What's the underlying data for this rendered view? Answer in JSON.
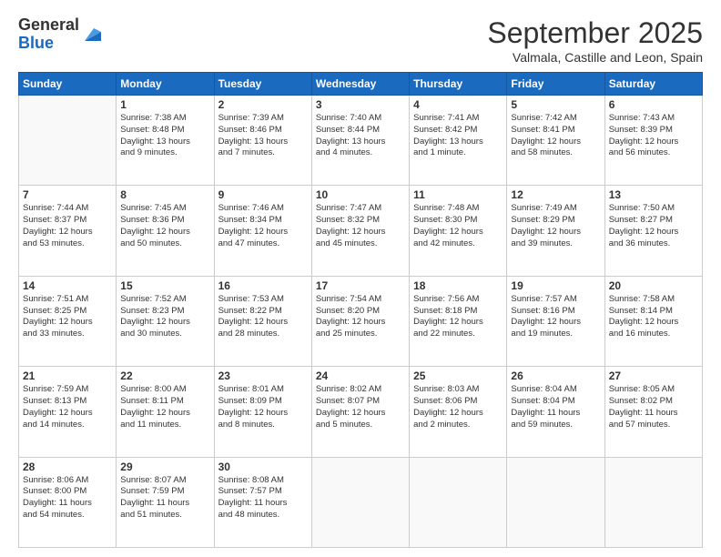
{
  "logo": {
    "general": "General",
    "blue": "Blue"
  },
  "header": {
    "month": "September 2025",
    "location": "Valmala, Castille and Leon, Spain"
  },
  "weekdays": [
    "Sunday",
    "Monday",
    "Tuesday",
    "Wednesday",
    "Thursday",
    "Friday",
    "Saturday"
  ],
  "weeks": [
    [
      {
        "day": "",
        "info": ""
      },
      {
        "day": "1",
        "info": "Sunrise: 7:38 AM\nSunset: 8:48 PM\nDaylight: 13 hours\nand 9 minutes."
      },
      {
        "day": "2",
        "info": "Sunrise: 7:39 AM\nSunset: 8:46 PM\nDaylight: 13 hours\nand 7 minutes."
      },
      {
        "day": "3",
        "info": "Sunrise: 7:40 AM\nSunset: 8:44 PM\nDaylight: 13 hours\nand 4 minutes."
      },
      {
        "day": "4",
        "info": "Sunrise: 7:41 AM\nSunset: 8:42 PM\nDaylight: 13 hours\nand 1 minute."
      },
      {
        "day": "5",
        "info": "Sunrise: 7:42 AM\nSunset: 8:41 PM\nDaylight: 12 hours\nand 58 minutes."
      },
      {
        "day": "6",
        "info": "Sunrise: 7:43 AM\nSunset: 8:39 PM\nDaylight: 12 hours\nand 56 minutes."
      }
    ],
    [
      {
        "day": "7",
        "info": "Sunrise: 7:44 AM\nSunset: 8:37 PM\nDaylight: 12 hours\nand 53 minutes."
      },
      {
        "day": "8",
        "info": "Sunrise: 7:45 AM\nSunset: 8:36 PM\nDaylight: 12 hours\nand 50 minutes."
      },
      {
        "day": "9",
        "info": "Sunrise: 7:46 AM\nSunset: 8:34 PM\nDaylight: 12 hours\nand 47 minutes."
      },
      {
        "day": "10",
        "info": "Sunrise: 7:47 AM\nSunset: 8:32 PM\nDaylight: 12 hours\nand 45 minutes."
      },
      {
        "day": "11",
        "info": "Sunrise: 7:48 AM\nSunset: 8:30 PM\nDaylight: 12 hours\nand 42 minutes."
      },
      {
        "day": "12",
        "info": "Sunrise: 7:49 AM\nSunset: 8:29 PM\nDaylight: 12 hours\nand 39 minutes."
      },
      {
        "day": "13",
        "info": "Sunrise: 7:50 AM\nSunset: 8:27 PM\nDaylight: 12 hours\nand 36 minutes."
      }
    ],
    [
      {
        "day": "14",
        "info": "Sunrise: 7:51 AM\nSunset: 8:25 PM\nDaylight: 12 hours\nand 33 minutes."
      },
      {
        "day": "15",
        "info": "Sunrise: 7:52 AM\nSunset: 8:23 PM\nDaylight: 12 hours\nand 30 minutes."
      },
      {
        "day": "16",
        "info": "Sunrise: 7:53 AM\nSunset: 8:22 PM\nDaylight: 12 hours\nand 28 minutes."
      },
      {
        "day": "17",
        "info": "Sunrise: 7:54 AM\nSunset: 8:20 PM\nDaylight: 12 hours\nand 25 minutes."
      },
      {
        "day": "18",
        "info": "Sunrise: 7:56 AM\nSunset: 8:18 PM\nDaylight: 12 hours\nand 22 minutes."
      },
      {
        "day": "19",
        "info": "Sunrise: 7:57 AM\nSunset: 8:16 PM\nDaylight: 12 hours\nand 19 minutes."
      },
      {
        "day": "20",
        "info": "Sunrise: 7:58 AM\nSunset: 8:14 PM\nDaylight: 12 hours\nand 16 minutes."
      }
    ],
    [
      {
        "day": "21",
        "info": "Sunrise: 7:59 AM\nSunset: 8:13 PM\nDaylight: 12 hours\nand 14 minutes."
      },
      {
        "day": "22",
        "info": "Sunrise: 8:00 AM\nSunset: 8:11 PM\nDaylight: 12 hours\nand 11 minutes."
      },
      {
        "day": "23",
        "info": "Sunrise: 8:01 AM\nSunset: 8:09 PM\nDaylight: 12 hours\nand 8 minutes."
      },
      {
        "day": "24",
        "info": "Sunrise: 8:02 AM\nSunset: 8:07 PM\nDaylight: 12 hours\nand 5 minutes."
      },
      {
        "day": "25",
        "info": "Sunrise: 8:03 AM\nSunset: 8:06 PM\nDaylight: 12 hours\nand 2 minutes."
      },
      {
        "day": "26",
        "info": "Sunrise: 8:04 AM\nSunset: 8:04 PM\nDaylight: 11 hours\nand 59 minutes."
      },
      {
        "day": "27",
        "info": "Sunrise: 8:05 AM\nSunset: 8:02 PM\nDaylight: 11 hours\nand 57 minutes."
      }
    ],
    [
      {
        "day": "28",
        "info": "Sunrise: 8:06 AM\nSunset: 8:00 PM\nDaylight: 11 hours\nand 54 minutes."
      },
      {
        "day": "29",
        "info": "Sunrise: 8:07 AM\nSunset: 7:59 PM\nDaylight: 11 hours\nand 51 minutes."
      },
      {
        "day": "30",
        "info": "Sunrise: 8:08 AM\nSunset: 7:57 PM\nDaylight: 11 hours\nand 48 minutes."
      },
      {
        "day": "",
        "info": ""
      },
      {
        "day": "",
        "info": ""
      },
      {
        "day": "",
        "info": ""
      },
      {
        "day": "",
        "info": ""
      }
    ]
  ]
}
